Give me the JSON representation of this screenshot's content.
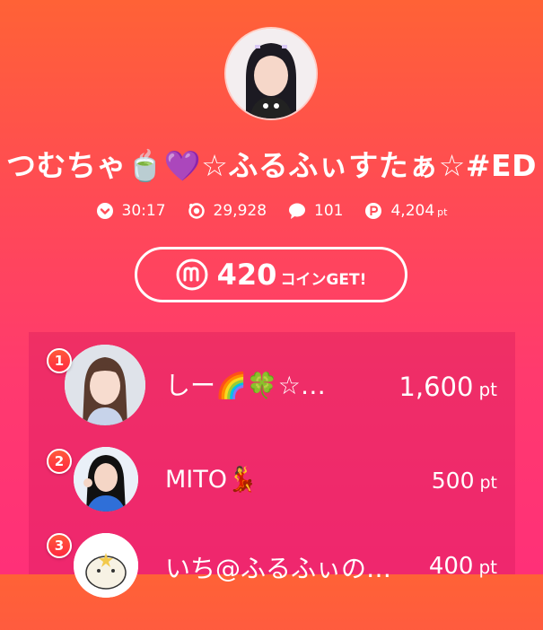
{
  "stream": {
    "title": "つむちゃ🍵💜☆ふるふぃすたぁ☆#ED",
    "stats": {
      "duration": "30:17",
      "viewers": "29,928",
      "comments": "101",
      "points": "4,204",
      "points_unit": "pt"
    },
    "icons": {
      "duration": "chevron-circle-icon",
      "viewers": "viewer-ring-icon",
      "comments": "speech-bubble-icon",
      "points": "p-coin-icon"
    }
  },
  "coin_button": {
    "amount": "420",
    "label": "コインGET!",
    "icon": "m-coin-icon"
  },
  "ranking": [
    {
      "rank": "1",
      "name": "しー🌈🍀☆…",
      "points": "1,600",
      "unit": "pt"
    },
    {
      "rank": "2",
      "name": "MITO💃",
      "points": "500",
      "unit": "pt"
    },
    {
      "rank": "3",
      "name": "いち@ふるふぃの…",
      "points": "400",
      "unit": "pt"
    }
  ],
  "colors": {
    "gradient_top": "#ff6236",
    "gradient_bottom": "#ff3078",
    "badge": "#ff3a3f",
    "text": "#ffffff"
  }
}
